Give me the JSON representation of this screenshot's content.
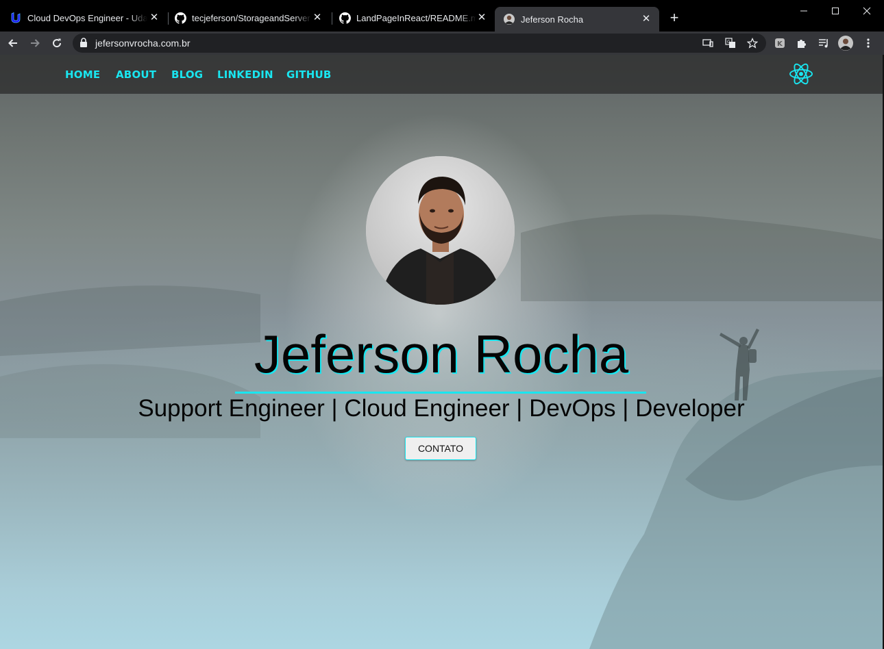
{
  "browser": {
    "tabs": [
      {
        "title": "Cloud DevOps Engineer - Udacity",
        "icon": "udacity-icon",
        "active": false
      },
      {
        "title": "tecjeferson/StorageandServer-Udacity",
        "icon": "github-icon",
        "active": false
      },
      {
        "title": "LandPageInReact/README.md at main",
        "icon": "github-icon",
        "active": false
      },
      {
        "title": "Jeferson Rocha",
        "icon": "avatar-icon",
        "active": true
      }
    ],
    "address": "jefersonvrocha.com.br"
  },
  "nav": {
    "items": [
      "HOME",
      "ABOUT",
      "BLOG",
      "LINKEDIN",
      "GITHUB"
    ]
  },
  "hero": {
    "name": "Jeferson Rocha",
    "subtitle": "Support Engineer | Cloud Engineer | DevOps | Developer",
    "button": "CONTATO"
  },
  "colors": {
    "accent": "#19e6f0",
    "navbar": "#2a2a2a",
    "text": "#050505"
  }
}
